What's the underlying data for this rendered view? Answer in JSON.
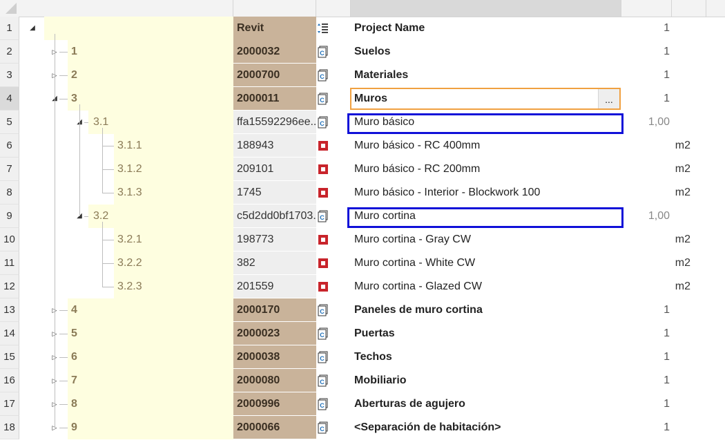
{
  "colors": {
    "tree_bg": "#fefee0",
    "code_bg_bold": "#c9b39a",
    "code_bg_light": "#eeeeee",
    "edit_border": "#f0a040",
    "highlight_border": "#1010d8",
    "icon_blue": "#1e6fb8",
    "icon_red": "#c8242b"
  },
  "header": {
    "code_label": "Revit",
    "desc_label": "Project Name",
    "qty": "1"
  },
  "edit": {
    "ellipsis": "..."
  },
  "rows": [
    {
      "num": "1",
      "label": "",
      "code": "Revit",
      "desc": "Project Name",
      "qty": "1",
      "unit": "",
      "level": -1,
      "icon": "list-icon",
      "toggle": "open"
    },
    {
      "num": "2",
      "label": "1",
      "code": "2000032",
      "desc": "Suelos",
      "qty": "1",
      "unit": "",
      "level": 0,
      "icon": "chapter-icon",
      "toggle": "closed"
    },
    {
      "num": "3",
      "label": "2",
      "code": "2000700",
      "desc": "Materiales",
      "qty": "1",
      "unit": "",
      "level": 0,
      "icon": "chapter-icon",
      "toggle": "closed"
    },
    {
      "num": "4",
      "label": "3",
      "code": "2000011",
      "desc": "Muros",
      "qty": "1",
      "unit": "",
      "level": 0,
      "icon": "chapter-icon",
      "toggle": "open"
    },
    {
      "num": "5",
      "label": "3.1",
      "code": "ffa15592296ee...",
      "desc": "Muro básico",
      "qty": "1,00",
      "unit": "",
      "level": 1,
      "icon": "chapter-icon",
      "toggle": "open"
    },
    {
      "num": "6",
      "label": "3.1.1",
      "code": "188943",
      "desc": "Muro básico - RC 400mm",
      "qty": "",
      "unit": "m2",
      "level": 2,
      "icon": "item-icon",
      "toggle": ""
    },
    {
      "num": "7",
      "label": "3.1.2",
      "code": "209101",
      "desc": "Muro básico - RC 200mm",
      "qty": "",
      "unit": "m2",
      "level": 2,
      "icon": "item-icon",
      "toggle": ""
    },
    {
      "num": "8",
      "label": "3.1.3",
      "code": "1745",
      "desc": "Muro básico - Interior - Blockwork 100",
      "qty": "",
      "unit": "m2",
      "level": 2,
      "icon": "item-icon",
      "toggle": ""
    },
    {
      "num": "9",
      "label": "3.2",
      "code": "c5d2dd0bf1703...",
      "desc": "Muro cortina",
      "qty": "1,00",
      "unit": "",
      "level": 1,
      "icon": "chapter-icon",
      "toggle": "open"
    },
    {
      "num": "10",
      "label": "3.2.1",
      "code": "198773",
      "desc": "Muro cortina - Gray CW",
      "qty": "",
      "unit": "m2",
      "level": 2,
      "icon": "item-icon",
      "toggle": ""
    },
    {
      "num": "11",
      "label": "3.2.2",
      "code": "382",
      "desc": "Muro cortina - White CW",
      "qty": "",
      "unit": "m2",
      "level": 2,
      "icon": "item-icon",
      "toggle": ""
    },
    {
      "num": "12",
      "label": "3.2.3",
      "code": "201559",
      "desc": "Muro cortina - Glazed CW",
      "qty": "",
      "unit": "m2",
      "level": 2,
      "icon": "item-icon",
      "toggle": ""
    },
    {
      "num": "13",
      "label": "4",
      "code": "2000170",
      "desc": "Paneles de muro cortina",
      "qty": "1",
      "unit": "",
      "level": 0,
      "icon": "chapter-icon",
      "toggle": "closed"
    },
    {
      "num": "14",
      "label": "5",
      "code": "2000023",
      "desc": "Puertas",
      "qty": "1",
      "unit": "",
      "level": 0,
      "icon": "chapter-icon",
      "toggle": "closed"
    },
    {
      "num": "15",
      "label": "6",
      "code": "2000038",
      "desc": "Techos",
      "qty": "1",
      "unit": "",
      "level": 0,
      "icon": "chapter-icon",
      "toggle": "closed"
    },
    {
      "num": "16",
      "label": "7",
      "code": "2000080",
      "desc": "Mobiliario",
      "qty": "1",
      "unit": "",
      "level": 0,
      "icon": "chapter-icon",
      "toggle": "closed"
    },
    {
      "num": "17",
      "label": "8",
      "code": "2000996",
      "desc": "Aberturas de agujero",
      "qty": "1",
      "unit": "",
      "level": 0,
      "icon": "chapter-icon",
      "toggle": "closed"
    },
    {
      "num": "18",
      "label": "9",
      "code": "2000066",
      "desc": "<Separación de habitación>",
      "qty": "1",
      "unit": "",
      "level": 0,
      "icon": "chapter-icon",
      "toggle": "closed"
    }
  ]
}
